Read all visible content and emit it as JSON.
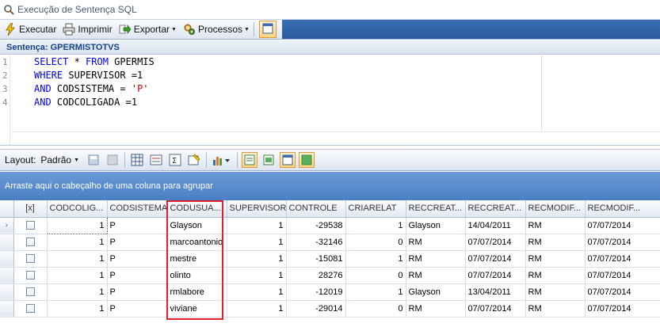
{
  "window": {
    "title": "Execução de Sentença SQL",
    "title_icon": "search-icon"
  },
  "toolbar": {
    "execute_label": "Executar",
    "print_label": "Imprimir",
    "export_label": "Exportar",
    "process_label": "Processos"
  },
  "sentence": {
    "label": "Sentença: GPERMISTOTVS"
  },
  "editor": {
    "line_numbers": [
      "1",
      "2",
      "3",
      "4"
    ],
    "lines": [
      [
        {
          "t": "SELECT",
          "c": "kw"
        },
        {
          "t": " * ",
          "c": "pl"
        },
        {
          "t": "FROM",
          "c": "kw"
        },
        {
          "t": " GPERMIS",
          "c": "id"
        }
      ],
      [
        {
          "t": "WHERE",
          "c": "kw"
        },
        {
          "t": " SUPERVISOR =1",
          "c": "id"
        }
      ],
      [
        {
          "t": "AND",
          "c": "kw"
        },
        {
          "t": " CODSISTEMA = ",
          "c": "id"
        },
        {
          "t": "'P'",
          "c": "str"
        }
      ],
      [
        {
          "t": "AND",
          "c": "kw"
        },
        {
          "t": " CODCOLIGADA =1",
          "c": "id"
        }
      ]
    ]
  },
  "layout_toolbar": {
    "layout_label": "Layout:",
    "preset_label": "Padrão"
  },
  "group_panel": {
    "hint": "Arraste aqui o cabeçalho de uma coluna para agrupar"
  },
  "grid": {
    "columns": [
      "[x]",
      "CODCOLIG...",
      "CODSISTEMA",
      "CODUSUA...",
      "SUPERVISOR",
      "CONTROLE",
      "CRIARELAT",
      "RECCREAT...",
      "RECCREAT...",
      "RECMODIF...",
      "RECMODIF..."
    ],
    "rows": [
      {
        "checked": false,
        "codcoligada": "1",
        "codsistema": "P",
        "codusuario": "Glayson",
        "supervisor": "1",
        "controle": "-29538",
        "criarelat": "1",
        "reccreatedby": "Glayson",
        "reccreatedon": "14/04/2011",
        "recmodifiedby": "RM",
        "recmodifiedon": "07/07/2014"
      },
      {
        "checked": false,
        "codcoligada": "1",
        "codsistema": "P",
        "codusuario": "marcoantonio",
        "supervisor": "1",
        "controle": "-32146",
        "criarelat": "0",
        "reccreatedby": "RM",
        "reccreatedon": "07/07/2014",
        "recmodifiedby": "RM",
        "recmodifiedon": "07/07/2014"
      },
      {
        "checked": false,
        "codcoligada": "1",
        "codsistema": "P",
        "codusuario": "mestre",
        "supervisor": "1",
        "controle": "-15081",
        "criarelat": "1",
        "reccreatedby": "RM",
        "reccreatedon": "07/07/2014",
        "recmodifiedby": "RM",
        "recmodifiedon": "07/07/2014"
      },
      {
        "checked": false,
        "codcoligada": "1",
        "codsistema": "P",
        "codusuario": "olinto",
        "supervisor": "1",
        "controle": "28276",
        "criarelat": "0",
        "reccreatedby": "RM",
        "reccreatedon": "07/07/2014",
        "recmodifiedby": "RM",
        "recmodifiedon": "07/07/2014"
      },
      {
        "checked": false,
        "codcoligada": "1",
        "codsistema": "P",
        "codusuario": "rmlabore",
        "supervisor": "1",
        "controle": "-12019",
        "criarelat": "1",
        "reccreatedby": "Glayson",
        "reccreatedon": "13/04/2011",
        "recmodifiedby": "RM",
        "recmodifiedon": "07/07/2014"
      },
      {
        "checked": false,
        "codcoligada": "1",
        "codsistema": "P",
        "codusuario": "viviane",
        "supervisor": "1",
        "controle": "-29014",
        "criarelat": "0",
        "reccreatedby": "RM",
        "reccreatedon": "07/07/2014",
        "recmodifiedby": "RM",
        "recmodifiedon": "07/07/2014"
      }
    ],
    "current_row_marker": "›",
    "highlight_color": "#e0202a"
  }
}
